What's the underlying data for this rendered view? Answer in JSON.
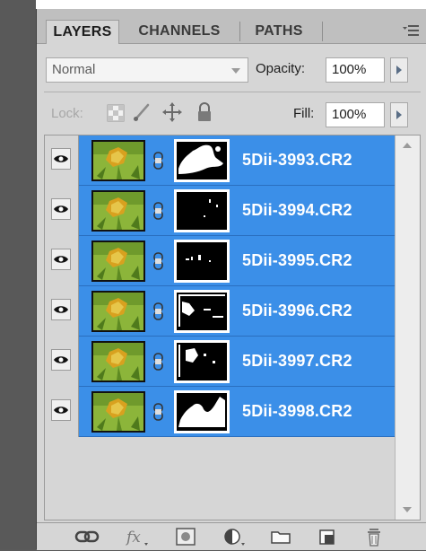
{
  "tabs": [
    {
      "label": "LAYERS",
      "active": true
    },
    {
      "label": "CHANNELS",
      "active": false
    },
    {
      "label": "PATHS",
      "active": false
    }
  ],
  "blend_mode": "Normal",
  "opacity": {
    "label": "Opacity:",
    "value": "100%"
  },
  "lock": {
    "label": "Lock:"
  },
  "fill": {
    "label": "Fill:",
    "value": "100%"
  },
  "layers": [
    {
      "name": "5Dii-3993.CR2",
      "visible": true,
      "selected": true
    },
    {
      "name": "5Dii-3994.CR2",
      "visible": true,
      "selected": true
    },
    {
      "name": "5Dii-3995.CR2",
      "visible": true,
      "selected": true
    },
    {
      "name": "5Dii-3996.CR2",
      "visible": true,
      "selected": true
    },
    {
      "name": "5Dii-3997.CR2",
      "visible": true,
      "selected": true
    },
    {
      "name": "5Dii-3998.CR2",
      "visible": true,
      "selected": true
    }
  ],
  "bottom_icons": [
    "link-layers-icon",
    "fx-icon",
    "add-mask-icon",
    "adjustment-layer-icon",
    "new-group-icon",
    "new-layer-icon",
    "delete-layer-icon"
  ],
  "colors": {
    "selection": "#3b8fe8",
    "panel": "#d6d6d6",
    "tab_bar": "#bfbfbf"
  }
}
